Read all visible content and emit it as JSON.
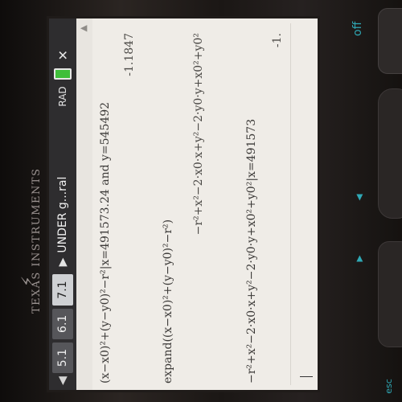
{
  "device": {
    "brand": "TEXAS INSTRUMENTS",
    "off_label": "off",
    "esc_label": "esc"
  },
  "topbar": {
    "tabs": [
      {
        "label": "5.1",
        "active": false
      },
      {
        "label": "6.1",
        "active": false
      },
      {
        "label": "7.1",
        "active": true
      }
    ],
    "document_title": "UNDER g...ral",
    "angle_mode": "RAD"
  },
  "history": [
    {
      "input": "(x−x0)²+(y−y0)²−r²|x=491573.24 and y=545492",
      "result": "-1.1847"
    },
    {
      "input": "expand((x−x0)²+(y−y0)²−r²)",
      "result": "−r²+x²−2·x0·x+y²−2·y0·y+x0²+y0²"
    },
    {
      "input": "−r²+x²−2·x0·x+y²−2·y0·y+x0²+y0²|x=491573",
      "result": "-1."
    }
  ],
  "colors": {
    "screen_bg": "#efece7",
    "topbar_bg": "#2e2d2f",
    "accent_teal": "#2fa9b6",
    "battery": "#3fbf3a"
  }
}
